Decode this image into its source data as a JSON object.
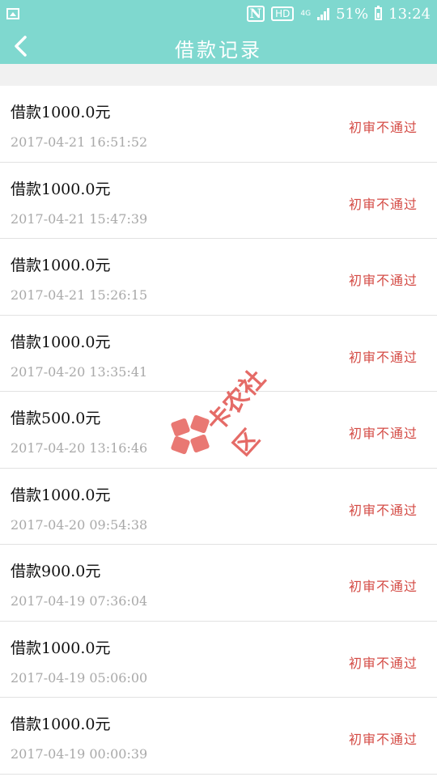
{
  "status_bar": {
    "network": "4G",
    "battery": "51%",
    "time": "13:24"
  },
  "header": {
    "title": "借款记录"
  },
  "records": [
    {
      "amount": "借款1000.0元",
      "time": "2017-04-21 16:51:52",
      "status": "初审不通过"
    },
    {
      "amount": "借款1000.0元",
      "time": "2017-04-21 15:47:39",
      "status": "初审不通过"
    },
    {
      "amount": "借款1000.0元",
      "time": "2017-04-21 15:26:15",
      "status": "初审不通过"
    },
    {
      "amount": "借款1000.0元",
      "time": "2017-04-20 13:35:41",
      "status": "初审不通过"
    },
    {
      "amount": "借款500.0元",
      "time": "2017-04-20 13:16:46",
      "status": "初审不通过"
    },
    {
      "amount": "借款1000.0元",
      "time": "2017-04-20 09:54:38",
      "status": "初审不通过"
    },
    {
      "amount": "借款900.0元",
      "time": "2017-04-19 07:36:04",
      "status": "初审不通过"
    },
    {
      "amount": "借款1000.0元",
      "time": "2017-04-19 05:06:00",
      "status": "初审不通过"
    },
    {
      "amount": "借款1000.0元",
      "time": "2017-04-19 00:00:39",
      "status": "初审不通过"
    }
  ],
  "watermark": {
    "text": "卡农社区"
  },
  "colors": {
    "header_bg": "#7fd8cf",
    "status_red": "#d44b45",
    "time_gray": "#a9a9a9"
  }
}
